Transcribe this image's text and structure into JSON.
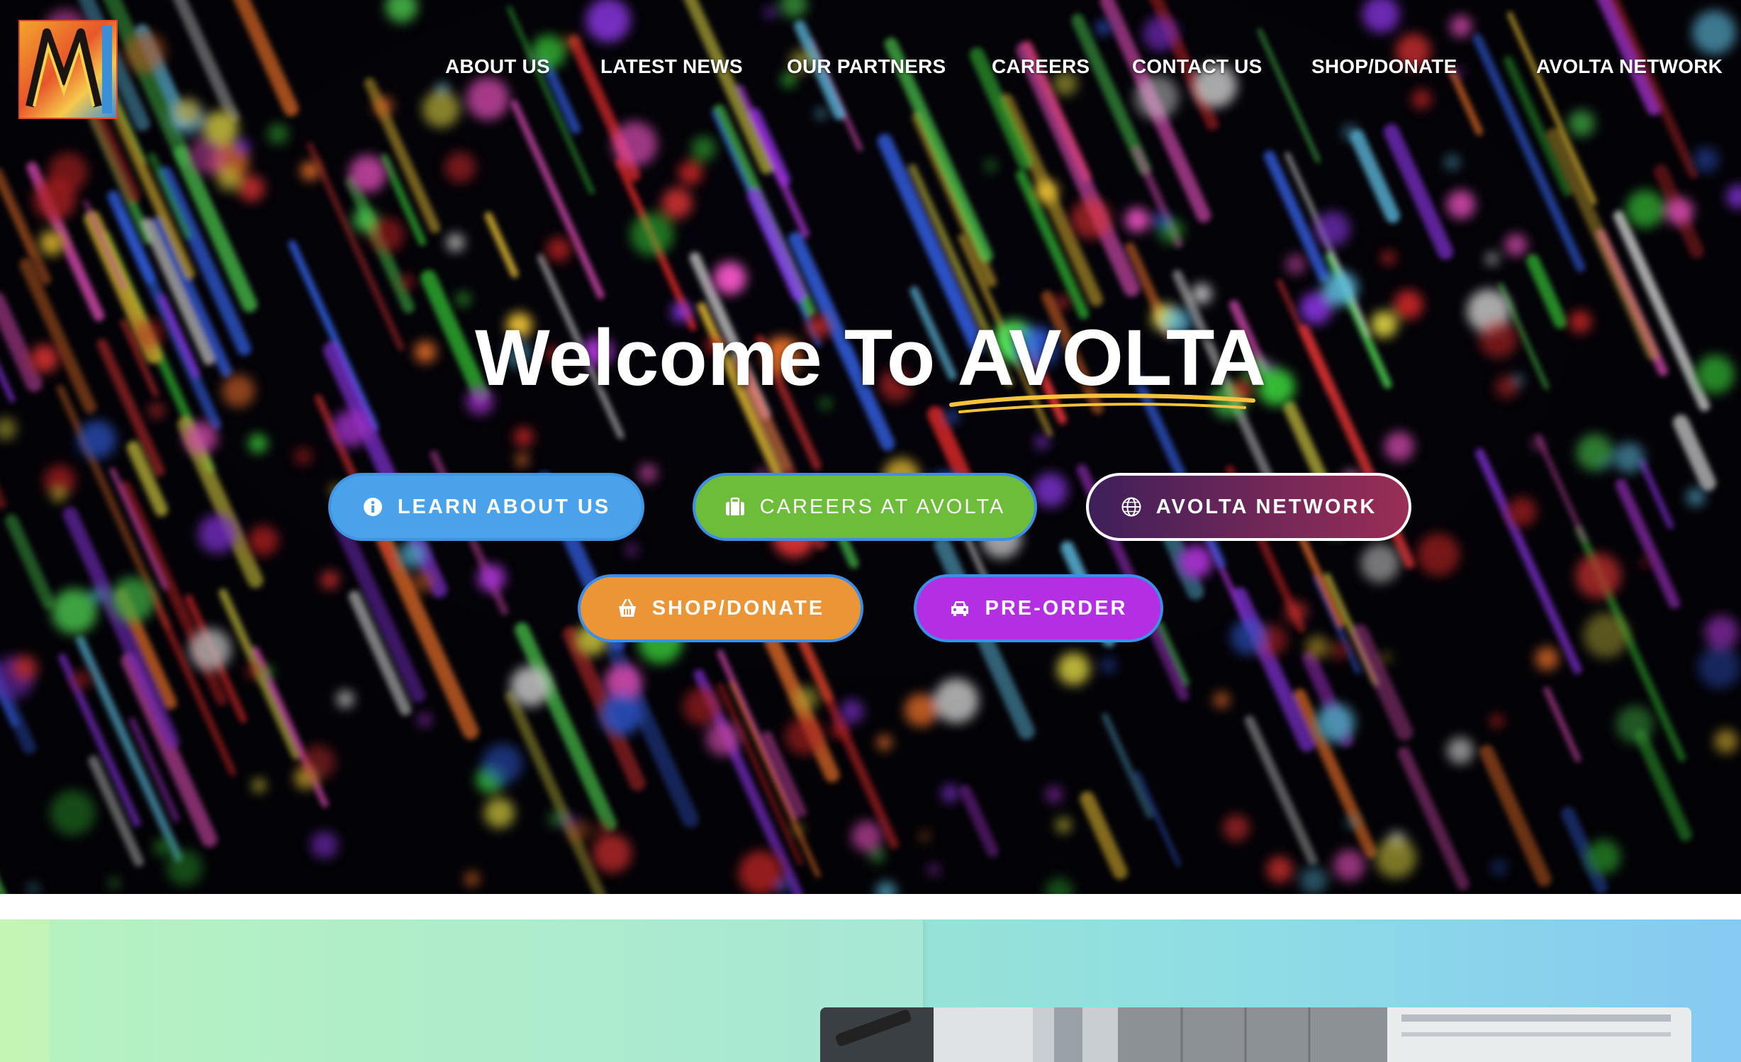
{
  "header": {
    "logo_icon": "avolta-logo-icon",
    "nav": [
      {
        "label": "ABOUT US"
      },
      {
        "label": "LATEST NEWS"
      },
      {
        "label": "OUR PARTNERS"
      },
      {
        "label": "CAREERS"
      },
      {
        "label": "CONTACT US"
      },
      {
        "label": "SHOP/DONATE"
      },
      {
        "label": "AVOLTA NETWORK"
      }
    ]
  },
  "hero": {
    "title_prefix": "Welcome To",
    "title_accent": "AVOLTA",
    "accent_underline_color": "#f5c33b",
    "buttons": [
      {
        "label": "LEARN ABOUT US",
        "icon": "info-circle-icon",
        "color": "#4aa3ea"
      },
      {
        "label": "CAREERS AT AVOLTA",
        "icon": "briefcase-icon",
        "color": "#6dbc3a"
      },
      {
        "label": "AVOLTA NETWORK",
        "icon": "globe-icon",
        "color": "#7a2a58"
      },
      {
        "label": "SHOP/DONATE",
        "icon": "basket-icon",
        "color": "#ec9537"
      },
      {
        "label": "PRE-ORDER",
        "icon": "car-icon",
        "color": "#b42ee4"
      }
    ]
  },
  "colors": {
    "button_border": "#3b8fe8",
    "section_gradient_start": "#c5f5b4",
    "section_gradient_end": "#86c9f2"
  }
}
